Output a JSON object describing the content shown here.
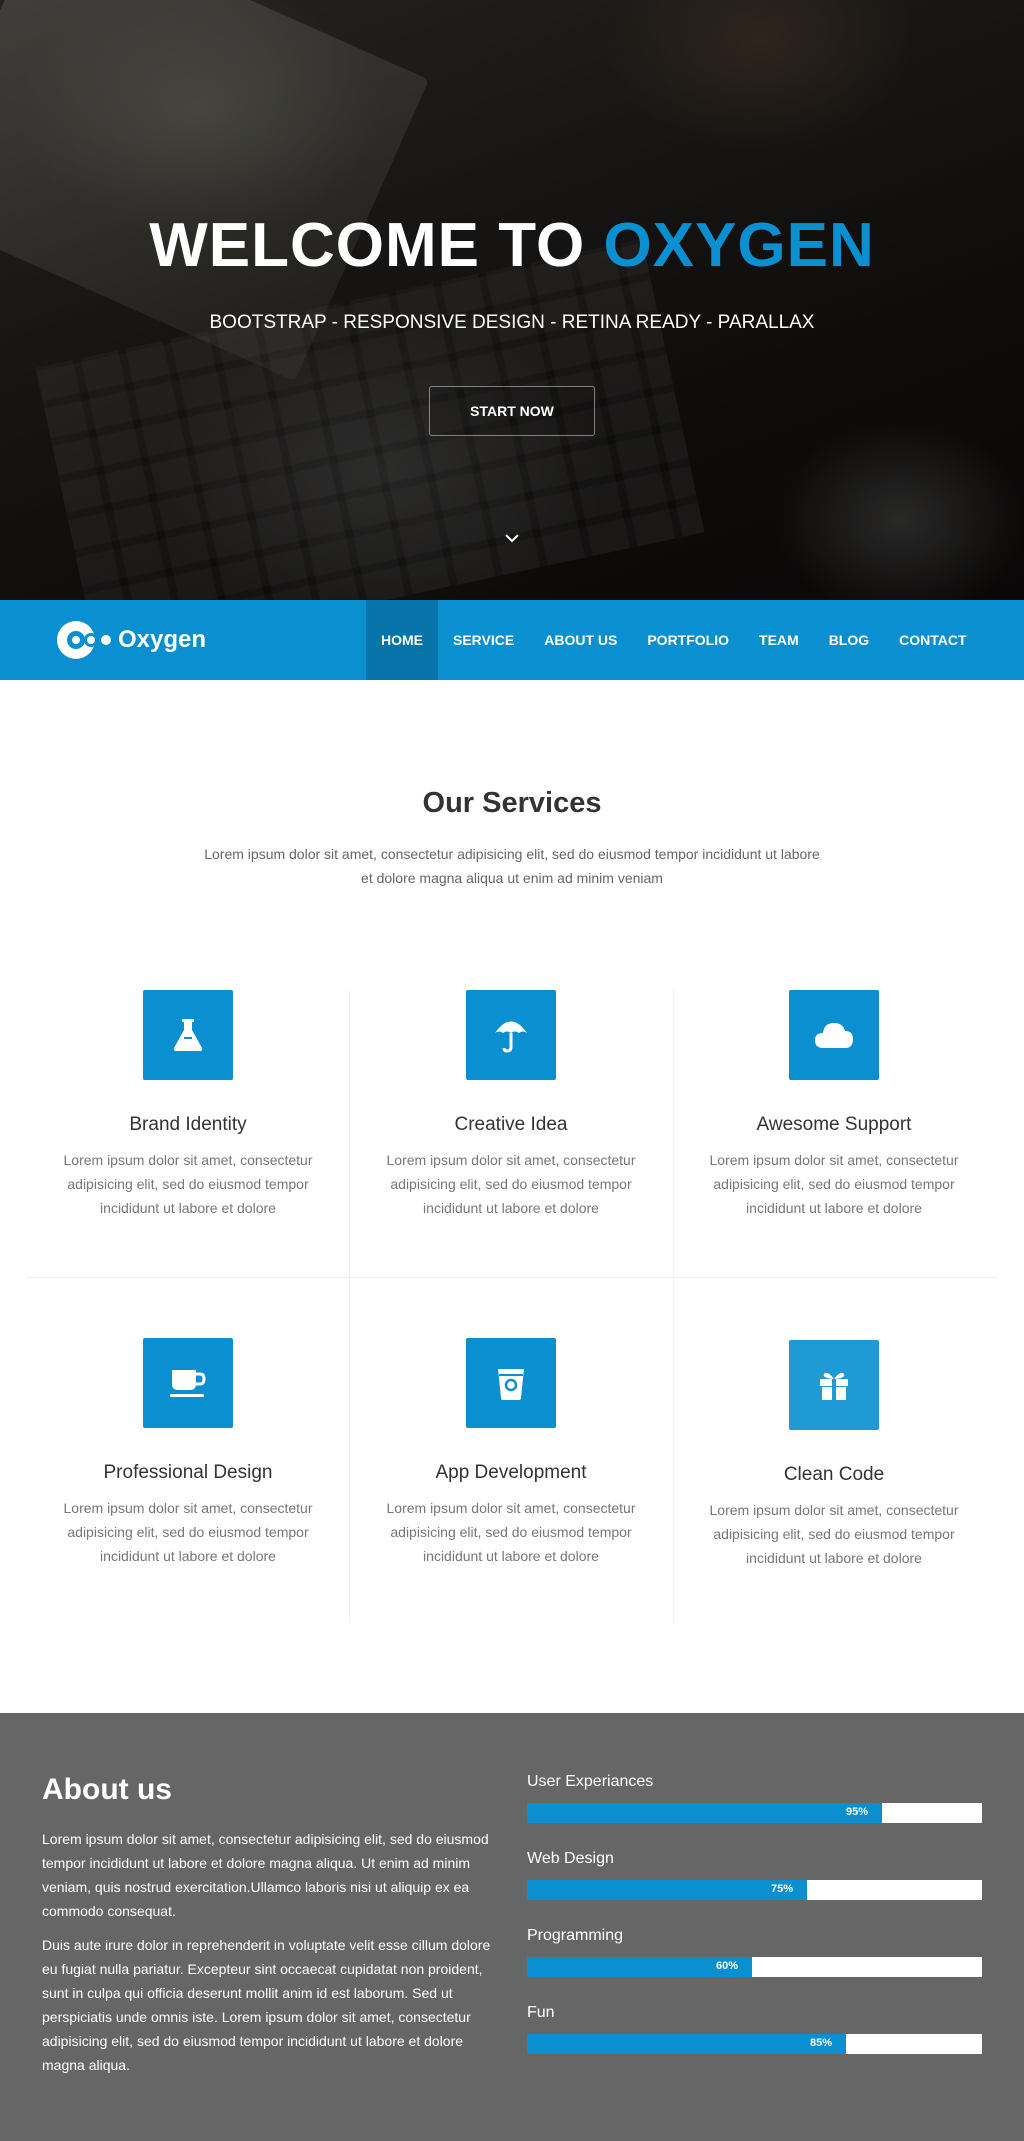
{
  "hero": {
    "title_main": "WELCOME TO ",
    "title_accent": "OXYGEN",
    "subtitle": "BOOTSTRAP - RESPONSIVE DESIGN - RETINA READY - PARALLAX",
    "cta_label": "START NOW",
    "scroll_icon": "chevron-down-icon"
  },
  "brand": {
    "name": "Oxygen",
    "color": "#0a8fd0"
  },
  "nav": {
    "items": [
      {
        "label": "HOME",
        "active": true
      },
      {
        "label": "SERVICE"
      },
      {
        "label": "ABOUT US"
      },
      {
        "label": "PORTFOLIO"
      },
      {
        "label": "TEAM"
      },
      {
        "label": "BLOG"
      },
      {
        "label": "CONTACT"
      }
    ]
  },
  "services": {
    "title": "Our Services",
    "intro": "Lorem ipsum dolor sit amet, consectetur adipisicing elit, sed do eiusmod tempor incididunt ut labore et dolore magna aliqua ut enim ad minim veniam",
    "items": [
      {
        "title": "Brand Identity",
        "icon": "flask-icon",
        "text": "Lorem ipsum dolor sit amet, consectetur adipisicing elit, sed do eiusmod tempor incididunt ut labore et dolore"
      },
      {
        "title": "Creative Idea",
        "icon": "umbrella-icon",
        "text": "Lorem ipsum dolor sit amet, consectetur adipisicing elit, sed do eiusmod tempor incididunt ut labore et dolore"
      },
      {
        "title": "Awesome Support",
        "icon": "cloud-icon",
        "text": "Lorem ipsum dolor sit amet, consectetur adipisicing elit, sed do eiusmod tempor incididunt ut labore et dolore"
      },
      {
        "title": "Professional Design",
        "icon": "coffee-icon",
        "text": "Lorem ipsum dolor sit amet, consectetur adipisicing elit, sed do eiusmod tempor incididunt ut labore et dolore"
      },
      {
        "title": "App Development",
        "icon": "bucket-icon",
        "text": "Lorem ipsum dolor sit amet, consectetur adipisicing elit, sed do eiusmod tempor incididunt ut labore et dolore"
      },
      {
        "title": "Clean Code",
        "icon": "gift-icon",
        "text": "Lorem ipsum dolor sit amet, consectetur adipisicing elit, sed do eiusmod tempor incididunt ut labore et dolore"
      }
    ]
  },
  "about": {
    "title": "About us",
    "p1": "Lorem ipsum dolor sit amet, consectetur adipisicing elit, sed do eiusmod tempor incididunt ut labore et dolore magna aliqua. Ut enim ad minim veniam, quis nostrud exercitation.Ullamco laboris nisi ut aliquip ex ea commodo consequat.",
    "p2": "Duis aute irure dolor in reprehenderit in voluptate velit esse cillum dolore eu fugiat nulla pariatur. Excepteur sint occaecat cupidatat non proident, sunt in culpa qui officia deserunt mollit anim id est laborum. Sed ut perspiciatis unde omnis iste. Lorem ipsum dolor sit amet, consectetur adipisicing elit, sed do eiusmod tempor incididunt ut labore et dolore magna aliqua.",
    "skills": [
      {
        "label": "User Experiances",
        "percent_label": "95%",
        "fill_fraction": 0.78
      },
      {
        "label": "Web Design",
        "percent_label": "75%",
        "fill_fraction": 0.615
      },
      {
        "label": "Programming",
        "percent_label": "60%",
        "fill_fraction": 0.495
      },
      {
        "label": "Fun",
        "percent_label": "85%",
        "fill_fraction": 0.7
      }
    ]
  }
}
